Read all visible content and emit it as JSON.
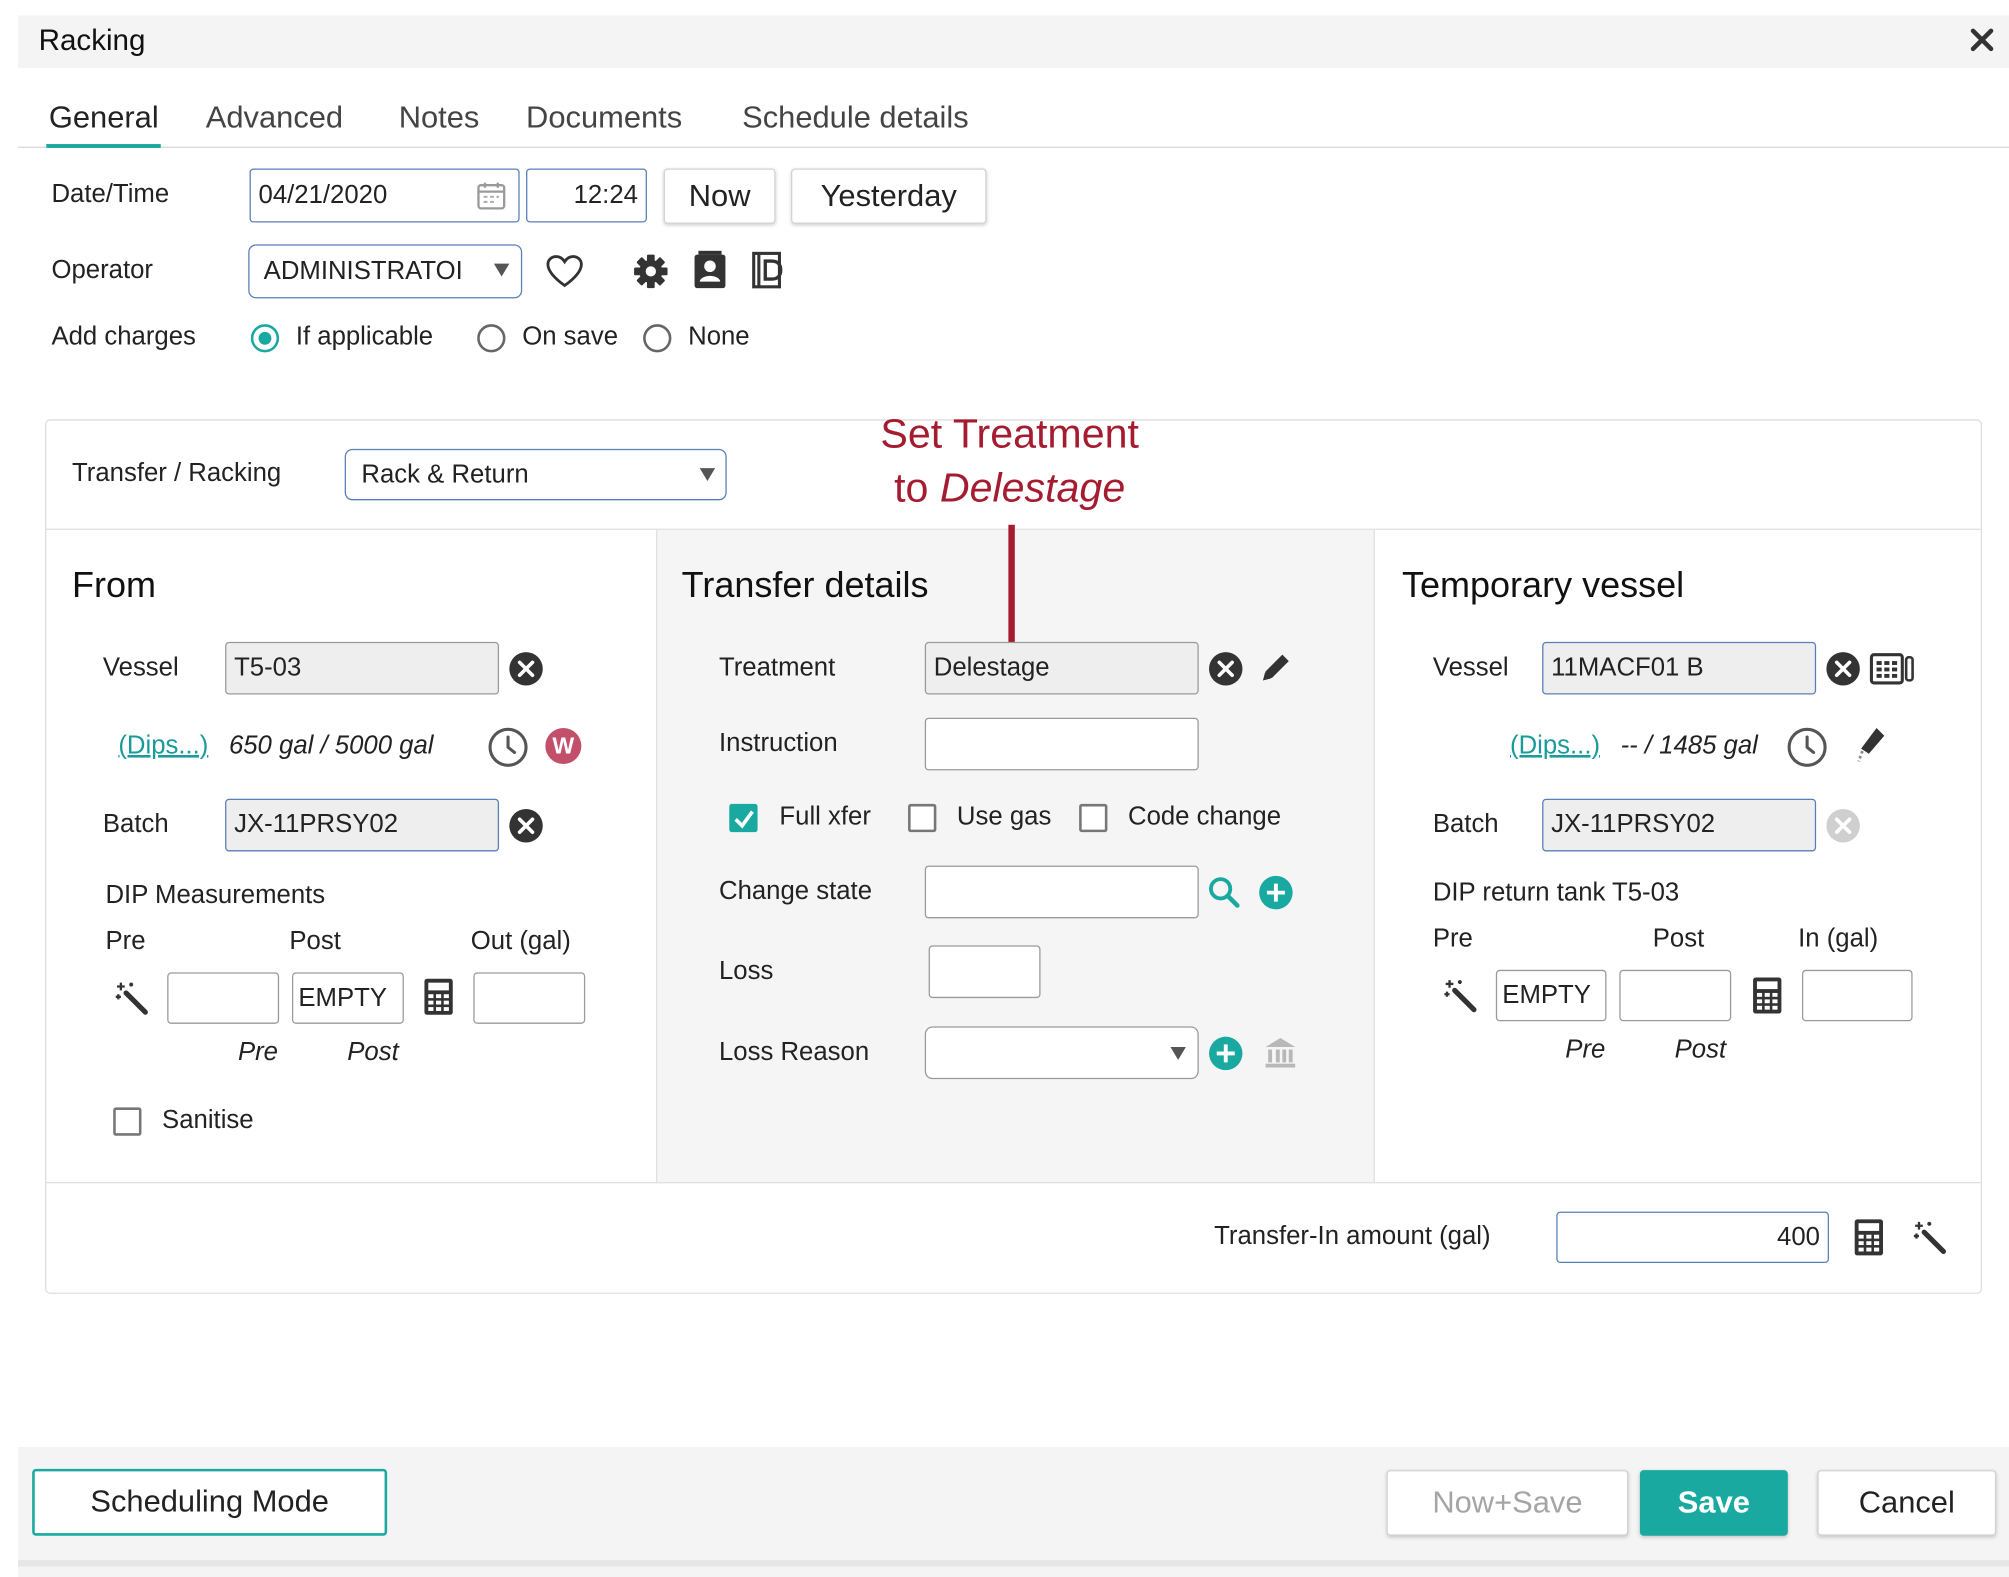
{
  "window": {
    "title": "Racking"
  },
  "tabs": [
    "General",
    "Advanced",
    "Notes",
    "Documents",
    "Schedule details"
  ],
  "general": {
    "datetime_label": "Date/Time",
    "date_value": "04/21/2020",
    "time_value": "12:24",
    "now_label": "Now",
    "yesterday_label": "Yesterday",
    "operator_label": "Operator",
    "operator_value": "ADMINISTRATOI",
    "add_charges_label": "Add charges",
    "charges_options": [
      "If applicable",
      "On save",
      "None"
    ],
    "charges_selected": "If applicable"
  },
  "transfer": {
    "label": "Transfer / Racking",
    "type_value": "Rack & Return"
  },
  "annotation": {
    "line1": "Set Treatment",
    "line2_prefix": "to ",
    "line2_emph": "Delestage"
  },
  "from": {
    "heading": "From",
    "vessel_label": "Vessel",
    "vessel_value": "T5-03",
    "dips_link": "(Dips...)",
    "volume_text": "650 gal / 5000 gal",
    "w_badge": "W",
    "batch_label": "Batch",
    "batch_value": "JX-11PRSY02",
    "dip_heading": "DIP Measurements",
    "col_pre": "Pre",
    "col_post": "Post",
    "col_out": "Out (gal)",
    "pre_value": "",
    "post_value": "EMPTY",
    "out_value": "",
    "sub_pre": "Pre",
    "sub_post": "Post",
    "sanitise_label": "Sanitise"
  },
  "details": {
    "heading": "Transfer details",
    "treatment_label": "Treatment",
    "treatment_value": "Delestage",
    "instruction_label": "Instruction",
    "instruction_value": "",
    "full_xfer_label": "Full xfer",
    "use_gas_label": "Use gas",
    "code_change_label": "Code change",
    "change_state_label": "Change state",
    "change_state_value": "",
    "loss_label": "Loss",
    "loss_value": "",
    "loss_reason_label": "Loss Reason",
    "loss_reason_value": ""
  },
  "temp": {
    "heading": "Temporary vessel",
    "vessel_label": "Vessel",
    "vessel_value": "11MACF01 B",
    "dips_link": "(Dips...)",
    "volume_text": "-- / 1485 gal",
    "batch_label": "Batch",
    "batch_value": "JX-11PRSY02",
    "dip_heading": "DIP return tank T5-03",
    "col_pre": "Pre",
    "col_post": "Post",
    "col_in": "In (gal)",
    "pre_value": "EMPTY",
    "post_value": "",
    "in_value": "",
    "sub_pre": "Pre",
    "sub_post": "Post"
  },
  "transfer_in": {
    "label": "Transfer-In amount (gal)",
    "value": "400"
  },
  "footer": {
    "scheduling_label": "Scheduling Mode",
    "now_save_label": "Now+Save",
    "save_label": "Save",
    "cancel_label": "Cancel"
  },
  "colors": {
    "accent": "#1aa9a0",
    "annotation": "#a51c30",
    "badge": "#c2506a"
  }
}
